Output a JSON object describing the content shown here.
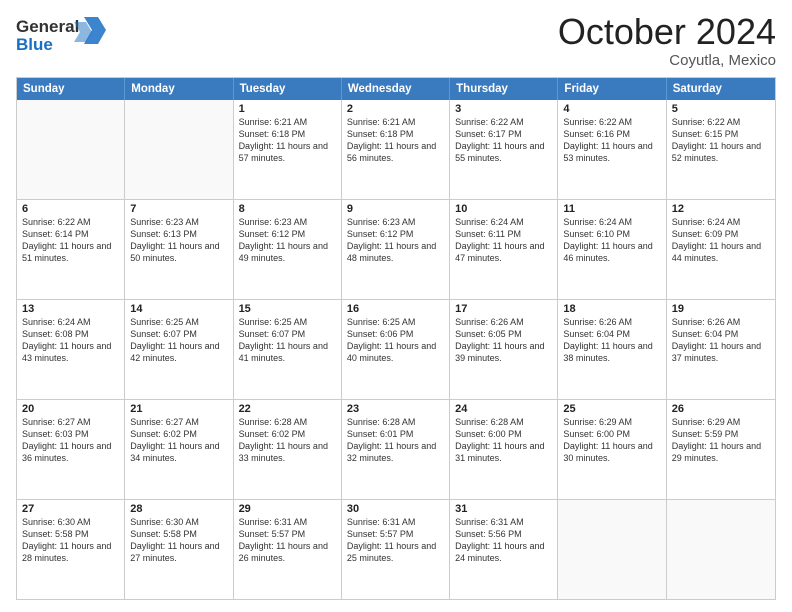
{
  "header": {
    "logo_general": "General",
    "logo_blue": "Blue",
    "title": "October 2024",
    "location": "Coyutla, Mexico"
  },
  "days_of_week": [
    "Sunday",
    "Monday",
    "Tuesday",
    "Wednesday",
    "Thursday",
    "Friday",
    "Saturday"
  ],
  "weeks": [
    [
      {
        "day": "",
        "sunrise": "",
        "sunset": "",
        "daylight": ""
      },
      {
        "day": "",
        "sunrise": "",
        "sunset": "",
        "daylight": ""
      },
      {
        "day": "1",
        "sunrise": "Sunrise: 6:21 AM",
        "sunset": "Sunset: 6:18 PM",
        "daylight": "Daylight: 11 hours and 57 minutes."
      },
      {
        "day": "2",
        "sunrise": "Sunrise: 6:21 AM",
        "sunset": "Sunset: 6:18 PM",
        "daylight": "Daylight: 11 hours and 56 minutes."
      },
      {
        "day": "3",
        "sunrise": "Sunrise: 6:22 AM",
        "sunset": "Sunset: 6:17 PM",
        "daylight": "Daylight: 11 hours and 55 minutes."
      },
      {
        "day": "4",
        "sunrise": "Sunrise: 6:22 AM",
        "sunset": "Sunset: 6:16 PM",
        "daylight": "Daylight: 11 hours and 53 minutes."
      },
      {
        "day": "5",
        "sunrise": "Sunrise: 6:22 AM",
        "sunset": "Sunset: 6:15 PM",
        "daylight": "Daylight: 11 hours and 52 minutes."
      }
    ],
    [
      {
        "day": "6",
        "sunrise": "Sunrise: 6:22 AM",
        "sunset": "Sunset: 6:14 PM",
        "daylight": "Daylight: 11 hours and 51 minutes."
      },
      {
        "day": "7",
        "sunrise": "Sunrise: 6:23 AM",
        "sunset": "Sunset: 6:13 PM",
        "daylight": "Daylight: 11 hours and 50 minutes."
      },
      {
        "day": "8",
        "sunrise": "Sunrise: 6:23 AM",
        "sunset": "Sunset: 6:12 PM",
        "daylight": "Daylight: 11 hours and 49 minutes."
      },
      {
        "day": "9",
        "sunrise": "Sunrise: 6:23 AM",
        "sunset": "Sunset: 6:12 PM",
        "daylight": "Daylight: 11 hours and 48 minutes."
      },
      {
        "day": "10",
        "sunrise": "Sunrise: 6:24 AM",
        "sunset": "Sunset: 6:11 PM",
        "daylight": "Daylight: 11 hours and 47 minutes."
      },
      {
        "day": "11",
        "sunrise": "Sunrise: 6:24 AM",
        "sunset": "Sunset: 6:10 PM",
        "daylight": "Daylight: 11 hours and 46 minutes."
      },
      {
        "day": "12",
        "sunrise": "Sunrise: 6:24 AM",
        "sunset": "Sunset: 6:09 PM",
        "daylight": "Daylight: 11 hours and 44 minutes."
      }
    ],
    [
      {
        "day": "13",
        "sunrise": "Sunrise: 6:24 AM",
        "sunset": "Sunset: 6:08 PM",
        "daylight": "Daylight: 11 hours and 43 minutes."
      },
      {
        "day": "14",
        "sunrise": "Sunrise: 6:25 AM",
        "sunset": "Sunset: 6:07 PM",
        "daylight": "Daylight: 11 hours and 42 minutes."
      },
      {
        "day": "15",
        "sunrise": "Sunrise: 6:25 AM",
        "sunset": "Sunset: 6:07 PM",
        "daylight": "Daylight: 11 hours and 41 minutes."
      },
      {
        "day": "16",
        "sunrise": "Sunrise: 6:25 AM",
        "sunset": "Sunset: 6:06 PM",
        "daylight": "Daylight: 11 hours and 40 minutes."
      },
      {
        "day": "17",
        "sunrise": "Sunrise: 6:26 AM",
        "sunset": "Sunset: 6:05 PM",
        "daylight": "Daylight: 11 hours and 39 minutes."
      },
      {
        "day": "18",
        "sunrise": "Sunrise: 6:26 AM",
        "sunset": "Sunset: 6:04 PM",
        "daylight": "Daylight: 11 hours and 38 minutes."
      },
      {
        "day": "19",
        "sunrise": "Sunrise: 6:26 AM",
        "sunset": "Sunset: 6:04 PM",
        "daylight": "Daylight: 11 hours and 37 minutes."
      }
    ],
    [
      {
        "day": "20",
        "sunrise": "Sunrise: 6:27 AM",
        "sunset": "Sunset: 6:03 PM",
        "daylight": "Daylight: 11 hours and 36 minutes."
      },
      {
        "day": "21",
        "sunrise": "Sunrise: 6:27 AM",
        "sunset": "Sunset: 6:02 PM",
        "daylight": "Daylight: 11 hours and 34 minutes."
      },
      {
        "day": "22",
        "sunrise": "Sunrise: 6:28 AM",
        "sunset": "Sunset: 6:02 PM",
        "daylight": "Daylight: 11 hours and 33 minutes."
      },
      {
        "day": "23",
        "sunrise": "Sunrise: 6:28 AM",
        "sunset": "Sunset: 6:01 PM",
        "daylight": "Daylight: 11 hours and 32 minutes."
      },
      {
        "day": "24",
        "sunrise": "Sunrise: 6:28 AM",
        "sunset": "Sunset: 6:00 PM",
        "daylight": "Daylight: 11 hours and 31 minutes."
      },
      {
        "day": "25",
        "sunrise": "Sunrise: 6:29 AM",
        "sunset": "Sunset: 6:00 PM",
        "daylight": "Daylight: 11 hours and 30 minutes."
      },
      {
        "day": "26",
        "sunrise": "Sunrise: 6:29 AM",
        "sunset": "Sunset: 5:59 PM",
        "daylight": "Daylight: 11 hours and 29 minutes."
      }
    ],
    [
      {
        "day": "27",
        "sunrise": "Sunrise: 6:30 AM",
        "sunset": "Sunset: 5:58 PM",
        "daylight": "Daylight: 11 hours and 28 minutes."
      },
      {
        "day": "28",
        "sunrise": "Sunrise: 6:30 AM",
        "sunset": "Sunset: 5:58 PM",
        "daylight": "Daylight: 11 hours and 27 minutes."
      },
      {
        "day": "29",
        "sunrise": "Sunrise: 6:31 AM",
        "sunset": "Sunset: 5:57 PM",
        "daylight": "Daylight: 11 hours and 26 minutes."
      },
      {
        "day": "30",
        "sunrise": "Sunrise: 6:31 AM",
        "sunset": "Sunset: 5:57 PM",
        "daylight": "Daylight: 11 hours and 25 minutes."
      },
      {
        "day": "31",
        "sunrise": "Sunrise: 6:31 AM",
        "sunset": "Sunset: 5:56 PM",
        "daylight": "Daylight: 11 hours and 24 minutes."
      },
      {
        "day": "",
        "sunrise": "",
        "sunset": "",
        "daylight": ""
      },
      {
        "day": "",
        "sunrise": "",
        "sunset": "",
        "daylight": ""
      }
    ]
  ]
}
